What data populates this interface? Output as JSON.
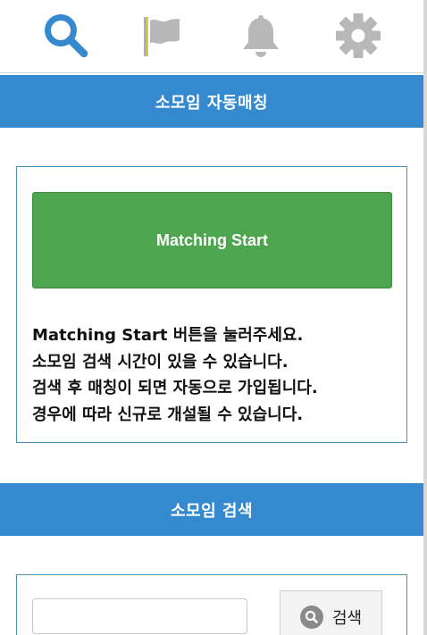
{
  "nav": {
    "items": [
      {
        "icon": "search-icon",
        "color": "#3489cf",
        "active": true
      },
      {
        "icon": "flag-icon",
        "color": "#b8b8b8",
        "active": false
      },
      {
        "icon": "bell-icon",
        "color": "#b8b8b8",
        "active": false
      },
      {
        "icon": "gear-icon",
        "color": "#b8b8b8",
        "active": false
      }
    ]
  },
  "matching": {
    "header": "소모임 자동매칭",
    "start_label": "Matching Start",
    "notice_lines": [
      "Matching Start 버튼을 눌러주세요.",
      "소모임 검색 시간이 있을 수 있습니다.",
      "검색 후 매칭이 되면 자동으로 가입됩니다.",
      "경우에 따라 신규로 개설될 수 있습니다."
    ]
  },
  "search": {
    "header": "소모임 검색",
    "input_value": "",
    "button_label": "검색"
  },
  "colors": {
    "header_bg": "#3489cf",
    "start_button": "#4da550",
    "nav_active": "#3489cf",
    "nav_inactive": "#b8b8b8"
  }
}
